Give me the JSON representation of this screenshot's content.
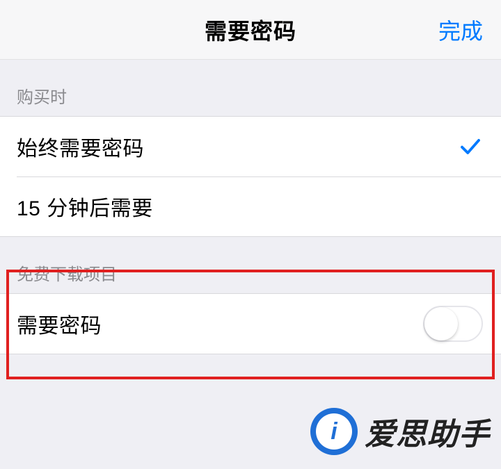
{
  "nav": {
    "title": "需要密码",
    "done": "完成"
  },
  "sections": {
    "purchase": {
      "header": "购买时",
      "options": [
        {
          "label": "始终需要密码",
          "selected": true
        },
        {
          "label": "15 分钟后需要",
          "selected": false
        }
      ]
    },
    "free": {
      "header": "免费下载项目",
      "toggle_label": "需要密码",
      "toggle_on": false
    }
  },
  "watermark": {
    "text": "爱思助手",
    "badge_letter": "i"
  }
}
